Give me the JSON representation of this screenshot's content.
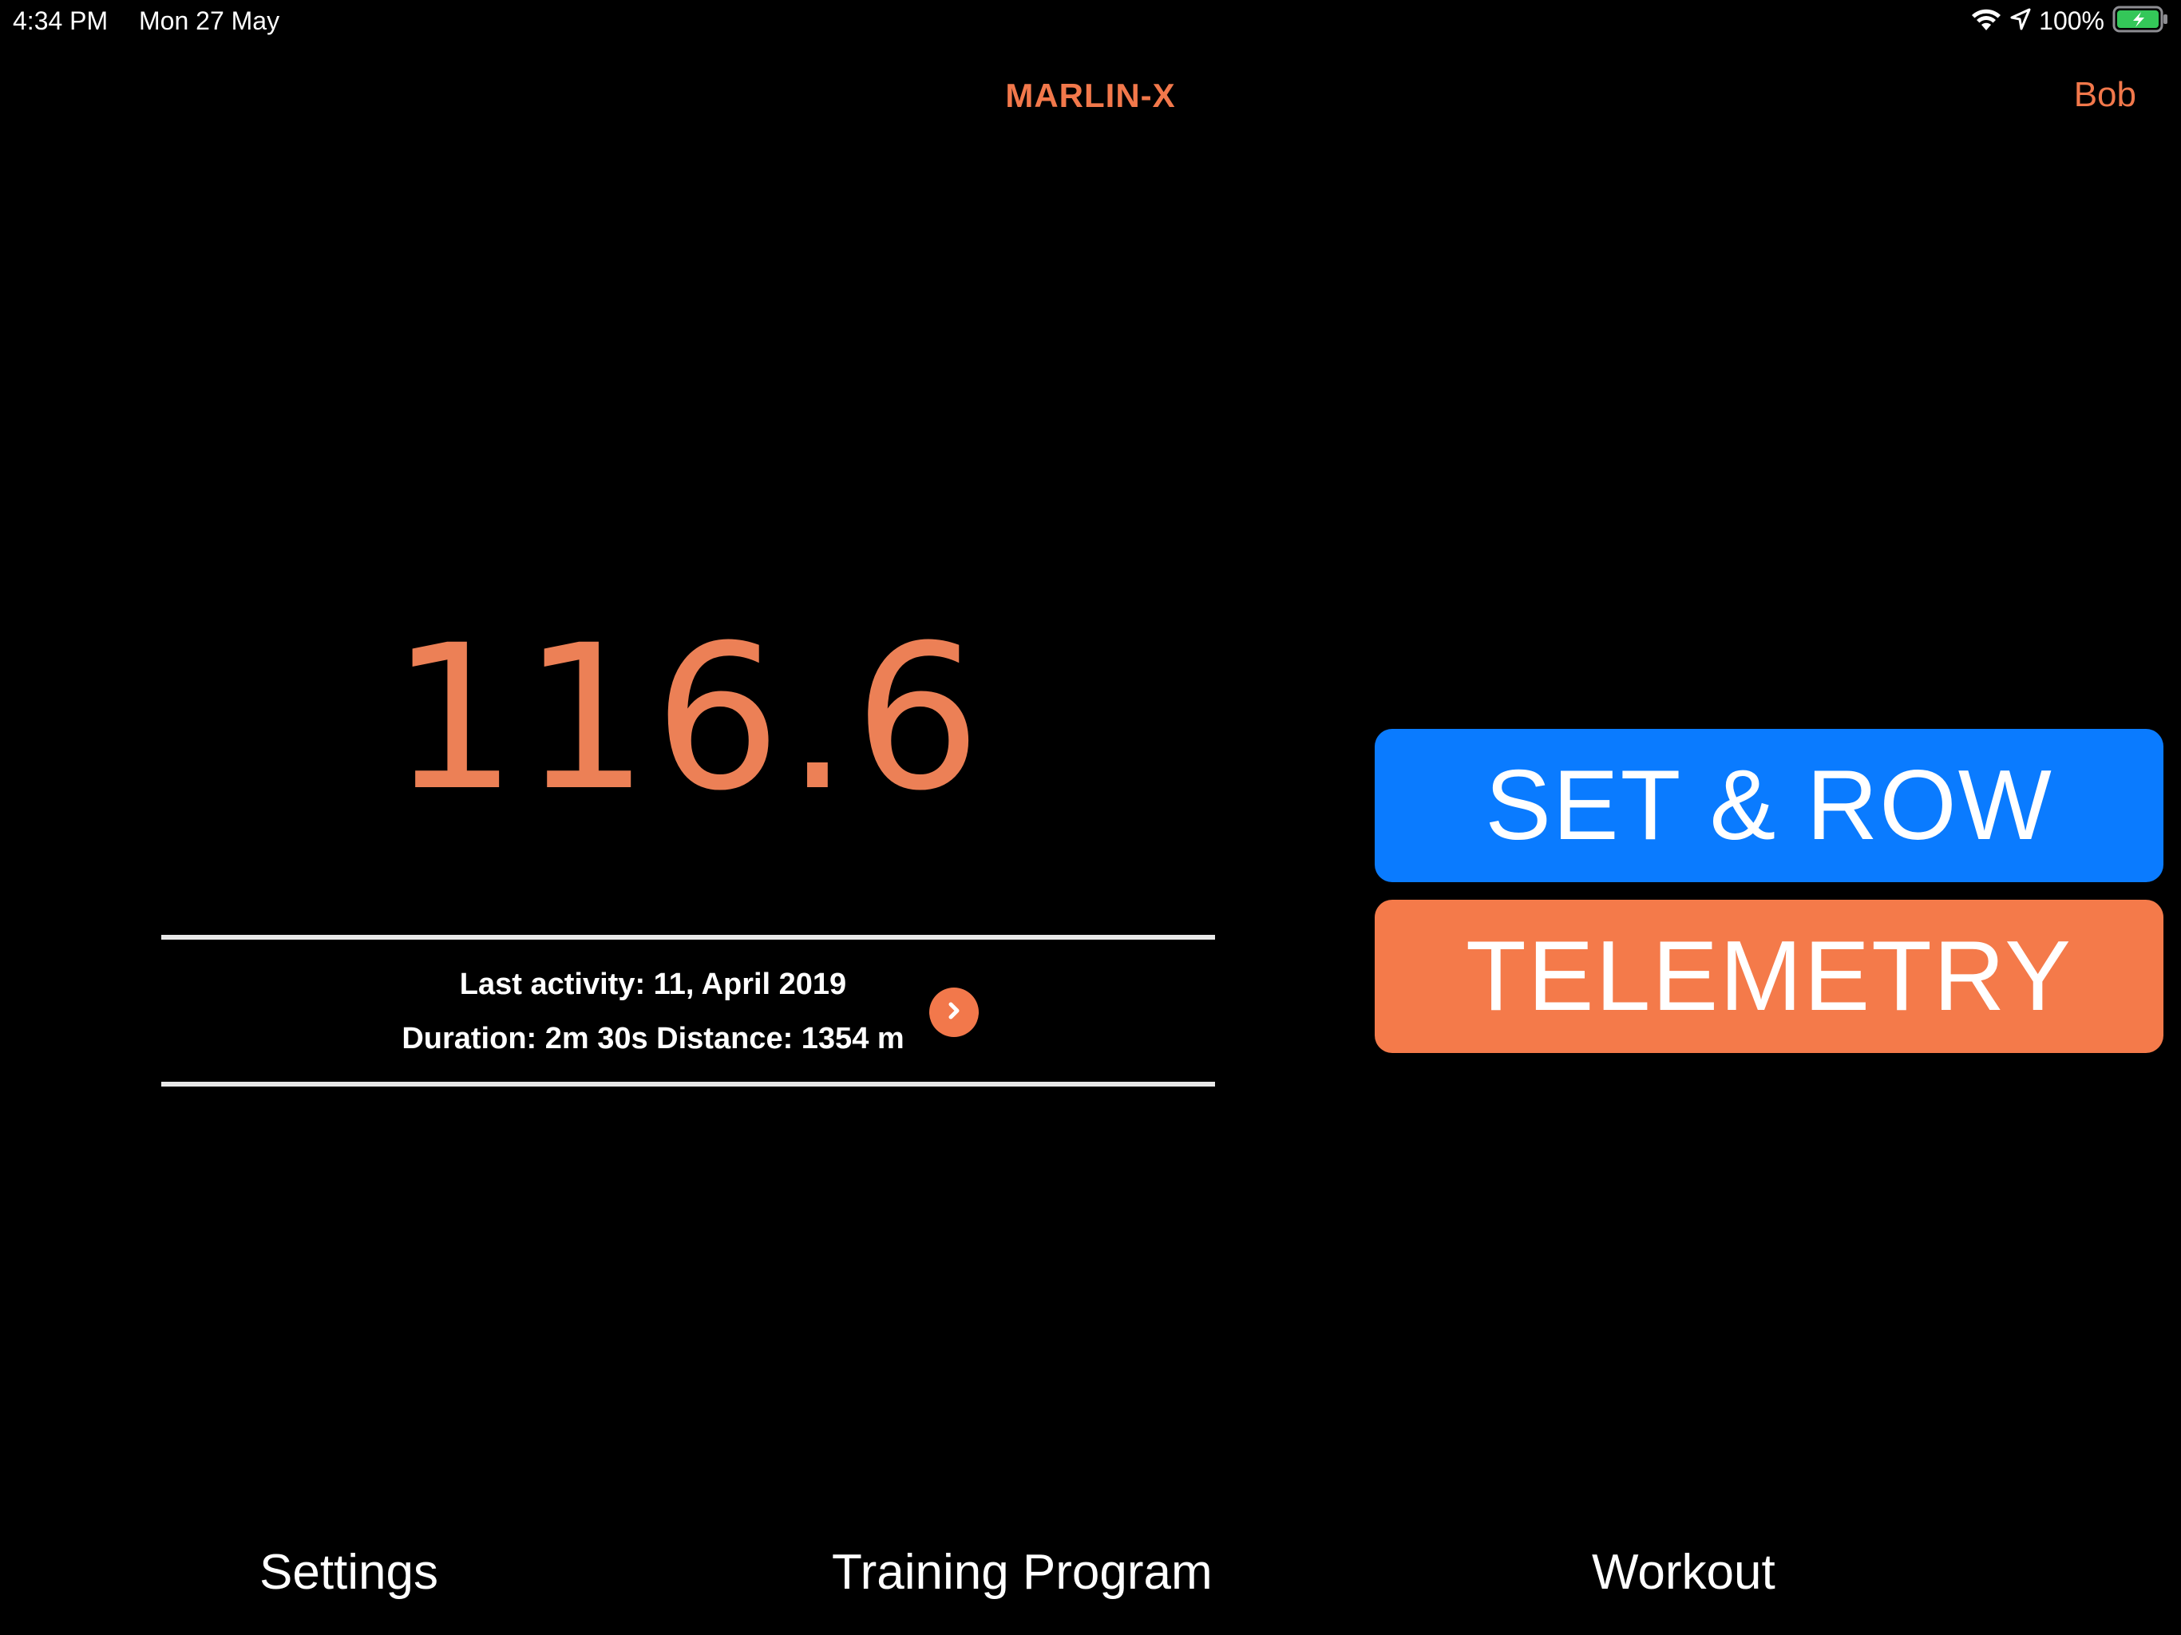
{
  "status_bar": {
    "time": "4:34 PM",
    "date": "Mon 27 May",
    "battery_percent": "100%",
    "icons": [
      "wifi-icon",
      "location-arrow-icon",
      "battery-charging-icon"
    ],
    "battery_color": "#34c759"
  },
  "nav": {
    "title": "MARLIN-X",
    "user": "Bob"
  },
  "main": {
    "value": "116.6",
    "last_activity": "Last activity:  11, April 2019",
    "summary": "Duration:  2m 30s Distance:  1354 m",
    "detail_icon": "chevron-right-icon"
  },
  "actions": {
    "set_row_label": "SET & ROW",
    "telemetry_label": "TELEMETRY"
  },
  "tabs": {
    "settings": "Settings",
    "training_program": "Training Program",
    "workout": "Workout"
  },
  "colors": {
    "accent": "#f2784b",
    "set_row_button": "#0a7bff",
    "telemetry_button": "#f47a4a",
    "background": "#000000"
  }
}
